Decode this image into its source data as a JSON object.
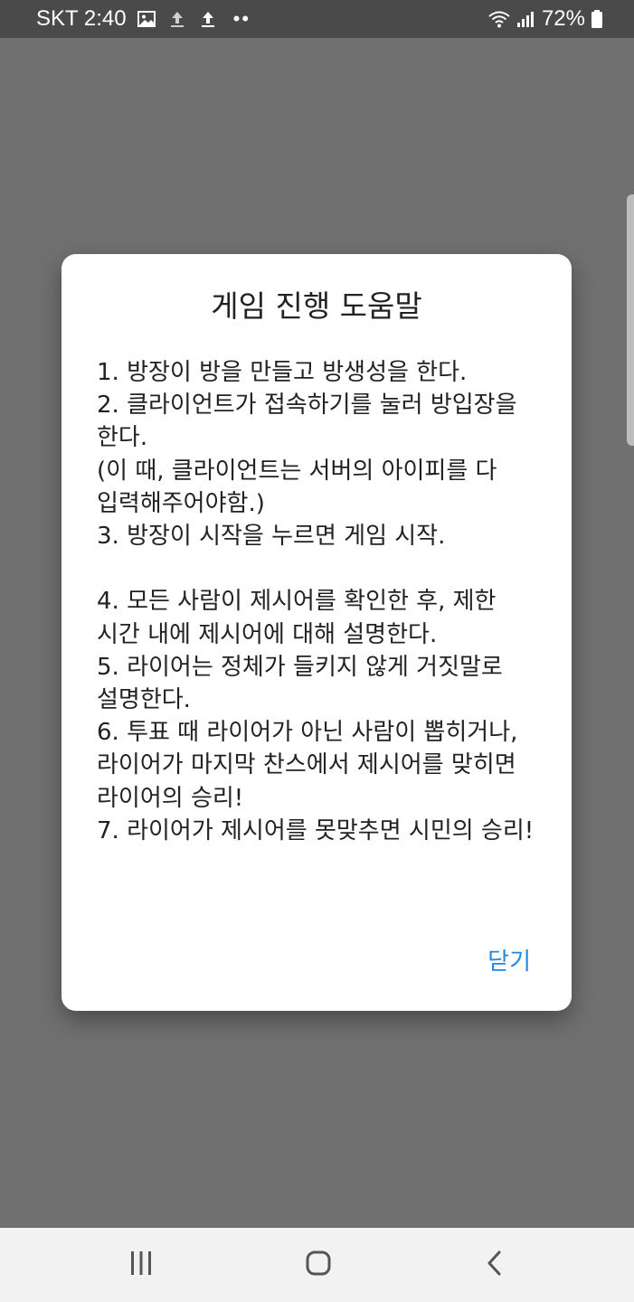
{
  "status_bar": {
    "carrier_time": "SKT 2:40",
    "battery_percent": "72%",
    "icons": [
      "image-icon",
      "upload-icon",
      "upload-icon",
      "more-dots-icon",
      "wifi-icon",
      "signal-icon",
      "battery-icon"
    ],
    "dots": "••"
  },
  "dialog": {
    "title": "게임 진행 도움말",
    "body": "1. 방장이 방을 만들고 방생성을 한다.\n2. 클라이언트가 접속하기를 눌러 방입장을 한다.\n(이 때, 클라이언트는 서버의 아이피를 다 입력해주어야함.)\n3. 방장이 시작을 누르면 게임 시작.\n\n4. 모든 사람이 제시어를 확인한 후, 제한 시간 내에 제시어에 대해 설명한다.\n5. 라이어는 정체가 들키지 않게 거짓말로 설명한다.\n6. 투표 때 라이어가 아닌 사람이 뽑히거나, 라이어가 마지막 찬스에서 제시어를 맞히면 라이어의 승리!\n7. 라이어가 제시어를 못맞추면 시민의 승리!",
    "close_label": "닫기"
  },
  "nav_bar": {
    "buttons": [
      "recent-apps-icon",
      "home-icon",
      "back-icon"
    ]
  },
  "colors": {
    "scrim": "#707070",
    "status_bar": "#4a4a4a",
    "dialog_bg": "#ffffff",
    "accent": "#1e88e5",
    "nav_bar": "#f2f2f2"
  }
}
